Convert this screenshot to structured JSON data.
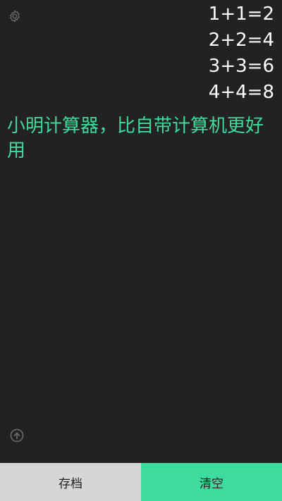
{
  "icons": {
    "settings": "gear-icon",
    "upload": "arrow-up-circle-icon"
  },
  "history": [
    "1+1=2",
    "2+2=4",
    "3+3=6",
    "4+4=8"
  ],
  "message": "小明计算器，比自带计算机更好用",
  "buttons": {
    "save": "存档",
    "clear": "清空"
  },
  "colors": {
    "background": "#222222",
    "accent": "#3ddb9d",
    "save_button_bg": "#d6d6d6"
  }
}
